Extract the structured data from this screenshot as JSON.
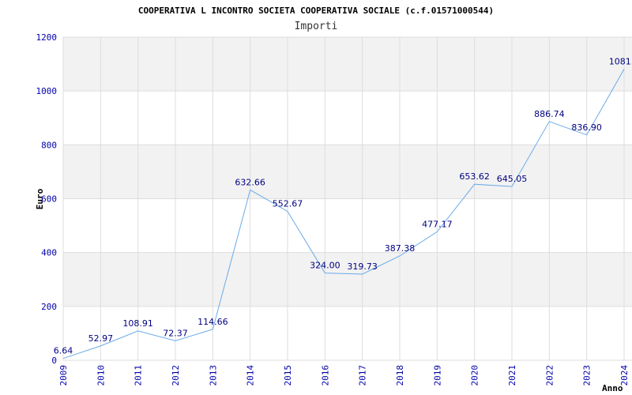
{
  "chart_data": {
    "type": "line",
    "title": "COOPERATIVA L INCONTRO SOCIETA COOPERATIVA SOCIALE (c.f.01571000544)",
    "subtitle": "Importi",
    "xlabel": "Anno",
    "ylabel": "Euro",
    "ylim": [
      0,
      1200
    ],
    "yticks": [
      "0",
      "200",
      "400",
      "600",
      "800",
      "1000",
      "1200"
    ],
    "grid": true,
    "categories": [
      "2009",
      "2010",
      "2011",
      "2012",
      "2013",
      "2014",
      "2015",
      "2016",
      "2017",
      "2018",
      "2019",
      "2020",
      "2021",
      "2022",
      "2023",
      "2024"
    ],
    "series": [
      {
        "values": [
          6.64,
          52.97,
          108.91,
          72.37,
          114.66,
          632.66,
          552.67,
          324.0,
          319.73,
          387.38,
          477.17,
          653.62,
          645.05,
          886.74,
          836.9,
          1081.3
        ],
        "labels": [
          "6.64",
          "52.97",
          "108.91",
          "72.37",
          "114.66",
          "632.66",
          "552.67",
          "324.00",
          "319.73",
          "387.38",
          "477.17",
          "653.62",
          "645.05",
          "886.74",
          "836.90",
          "1081.3"
        ]
      }
    ],
    "colors": {
      "line": "#6aaae8",
      "band": "#f2f2f2",
      "gridline": "#dddddd",
      "tick_text": "#0000aa",
      "label_text": "#000080"
    }
  }
}
